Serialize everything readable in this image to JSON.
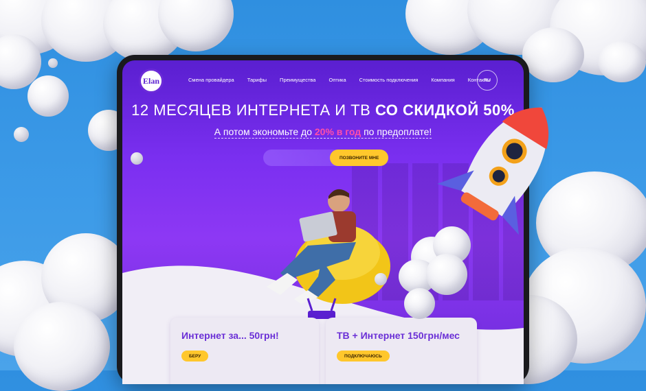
{
  "nav": {
    "logo_text": "Elan",
    "links": [
      "Смена провайдера",
      "Тарифы",
      "Преимущества",
      "Оптика",
      "Стоимость подключения",
      "Компания",
      "Контакты"
    ],
    "lang": "RU"
  },
  "hero": {
    "title_regular": "12 МЕСЯЦЕВ ИНТЕРНЕТА И ТВ ",
    "title_bold": "СО СКИДКОЙ 50%",
    "sub_before": "А потом экономьте до ",
    "sub_accent": "20% в год",
    "sub_after": " по предоплате!",
    "call_button": "ПОЗВОНИТЕ МНЕ"
  },
  "cards": [
    {
      "title": "Интернет за... 50грн!",
      "button": "БЕРУ"
    },
    {
      "title": "ТВ + Интернет 150грн/мес",
      "button": "ПОДКЛЮЧАЮСЬ"
    }
  ],
  "colors": {
    "accent_yellow": "#ffc72c",
    "accent_pink": "#ff4fa8",
    "brand_purple": "#6b2bd8",
    "sky_blue": "#3d9be8"
  }
}
